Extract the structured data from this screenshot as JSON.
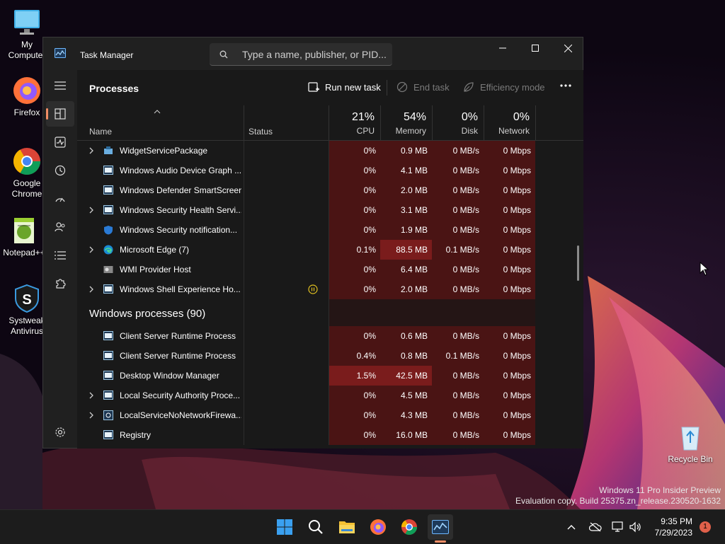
{
  "desktop": {
    "icons": [
      {
        "label": "My Computer",
        "icon": "computer-icon"
      },
      {
        "label": "Firefox",
        "icon": "firefox-icon"
      },
      {
        "label": "Google Chrome",
        "icon": "chrome-icon"
      },
      {
        "label": "Notepad++",
        "icon": "notepad-plus-icon"
      },
      {
        "label": "Systweak Antivirus",
        "icon": "antivirus-icon"
      },
      {
        "label": "Recycle Bin",
        "icon": "recycle-bin-icon"
      }
    ],
    "watermark": {
      "line1": "Windows 11 Pro Insider Preview",
      "line2": "Evaluation copy. Build 25375.zn_release.230520-1632"
    }
  },
  "window": {
    "title": "Task Manager",
    "search_placeholder": "Type a name, publisher, or PID...",
    "page_title": "Processes",
    "commands": {
      "run_new_task": "Run new task",
      "end_task": "End task",
      "efficiency_mode": "Efficiency mode"
    },
    "columns": {
      "name": "Name",
      "status": "Status",
      "cpu": {
        "pct": "21%",
        "label": "CPU"
      },
      "memory": {
        "pct": "54%",
        "label": "Memory"
      },
      "disk": {
        "pct": "0%",
        "label": "Disk"
      },
      "network": {
        "pct": "0%",
        "label": "Network"
      }
    },
    "group_windows": "Windows processes (90)",
    "rows_top": [
      {
        "name": "WidgetServicePackage",
        "expand": true,
        "cpu": "0%",
        "mem": "0.9 MB",
        "disk": "0 MB/s",
        "net": "0 Mbps"
      },
      {
        "name": "Windows Audio Device Graph ...",
        "expand": false,
        "cpu": "0%",
        "mem": "4.1 MB",
        "disk": "0 MB/s",
        "net": "0 Mbps"
      },
      {
        "name": "Windows Defender SmartScreen",
        "expand": false,
        "cpu": "0%",
        "mem": "2.0 MB",
        "disk": "0 MB/s",
        "net": "0 Mbps"
      },
      {
        "name": "Windows Security Health Servi...",
        "expand": true,
        "cpu": "0%",
        "mem": "3.1 MB",
        "disk": "0 MB/s",
        "net": "0 Mbps"
      },
      {
        "name": "Windows Security notification...",
        "expand": false,
        "cpu": "0%",
        "mem": "1.9 MB",
        "disk": "0 MB/s",
        "net": "0 Mbps"
      },
      {
        "name": "Microsoft Edge (7)",
        "expand": true,
        "cpu": "0.1%",
        "mem": "88.5 MB",
        "disk": "0.1 MB/s",
        "net": "0 Mbps"
      },
      {
        "name": "WMI Provider Host",
        "expand": false,
        "cpu": "0%",
        "mem": "6.4 MB",
        "disk": "0 MB/s",
        "net": "0 Mbps"
      },
      {
        "name": "Windows Shell Experience Ho...",
        "expand": true,
        "cpu": "0%",
        "mem": "2.0 MB",
        "disk": "0 MB/s",
        "net": "0 Mbps"
      }
    ],
    "rows_windows": [
      {
        "name": "Client Server Runtime Process",
        "expand": false,
        "cpu": "0%",
        "mem": "0.6 MB",
        "disk": "0 MB/s",
        "net": "0 Mbps"
      },
      {
        "name": "Client Server Runtime Process",
        "expand": false,
        "cpu": "0.4%",
        "mem": "0.8 MB",
        "disk": "0.1 MB/s",
        "net": "0 Mbps"
      },
      {
        "name": "Desktop Window Manager",
        "expand": false,
        "cpu": "1.5%",
        "mem": "42.5 MB",
        "disk": "0 MB/s",
        "net": "0 Mbps"
      },
      {
        "name": "Local Security Authority Proce...",
        "expand": true,
        "cpu": "0%",
        "mem": "4.5 MB",
        "disk": "0 MB/s",
        "net": "0 Mbps"
      },
      {
        "name": "LocalServiceNoNetworkFirewa...",
        "expand": true,
        "cpu": "0%",
        "mem": "4.3 MB",
        "disk": "0 MB/s",
        "net": "0 Mbps"
      },
      {
        "name": "Registry",
        "expand": false,
        "cpu": "0%",
        "mem": "16.0 MB",
        "disk": "0 MB/s",
        "net": "0 Mbps"
      }
    ]
  },
  "taskbar": {
    "time": "9:35 PM",
    "date": "7/29/2023",
    "notification_count": "1"
  },
  "colors": {
    "accent": "#f28d66",
    "heat_low": "#4a1414",
    "heat_high": "#7a1c1c",
    "window_bg": "#202020"
  }
}
